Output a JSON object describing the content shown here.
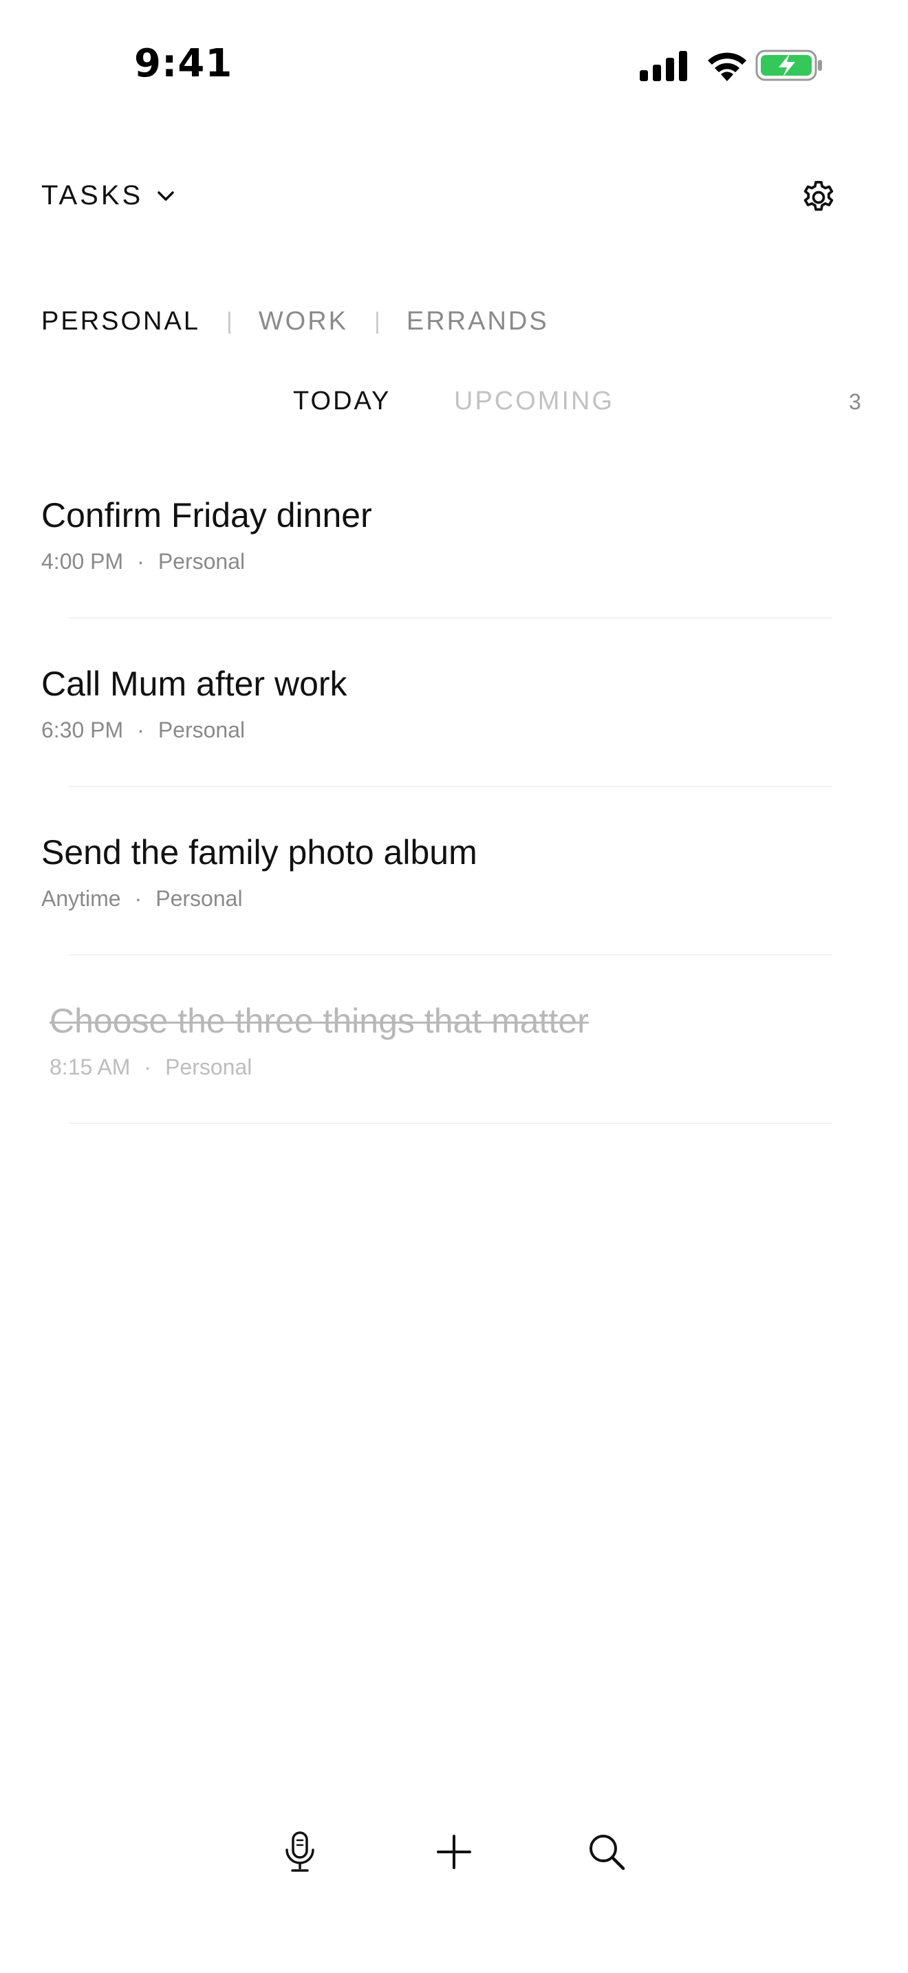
{
  "status_bar": {
    "time": "9:41",
    "battery_color": "#34c759"
  },
  "header": {
    "title": "TASKS"
  },
  "categories": [
    {
      "label": "PERSONAL",
      "active": true
    },
    {
      "label": "WORK",
      "active": false
    },
    {
      "label": "ERRANDS",
      "active": false
    }
  ],
  "filters": {
    "today": "TODAY",
    "upcoming": "UPCOMING",
    "count": "3"
  },
  "tasks": [
    {
      "title": "Confirm Friday dinner",
      "time": "4:00 PM",
      "separator": "·",
      "category": "Personal",
      "completed": false
    },
    {
      "title": "Call Mum after work",
      "time": "6:30 PM",
      "separator": "·",
      "category": "Personal",
      "completed": false
    },
    {
      "title": "Send the family photo album",
      "time": "Anytime",
      "separator": "·",
      "category": "Personal",
      "completed": false
    },
    {
      "title": "Choose the three things that matter",
      "time": "8:15 AM",
      "separator": "·",
      "category": "Personal",
      "completed": true
    }
  ],
  "toolbar": {
    "icons": [
      "microphone-icon",
      "plus-icon",
      "search-icon"
    ]
  },
  "colors": {
    "text_primary": "#111111",
    "text_secondary": "#8a8a8a",
    "text_disabled": "#c2c2c2",
    "battery": "#34c759"
  }
}
